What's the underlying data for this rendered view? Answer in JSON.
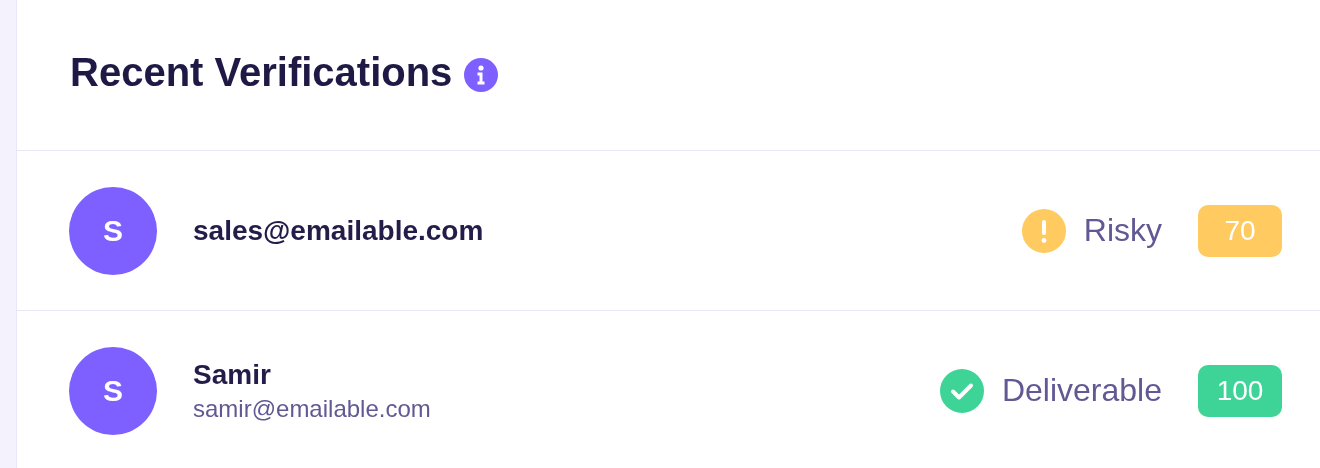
{
  "panel": {
    "title": "Recent Verifications"
  },
  "verifications": [
    {
      "avatar": "S",
      "email": "sales@emailable.com",
      "status": {
        "kind": "risky",
        "label": "Risky"
      },
      "score": "70"
    },
    {
      "avatar": "S",
      "name": "Samir",
      "email": "samir@emailable.com",
      "status": {
        "kind": "deliverable",
        "label": "Deliverable"
      },
      "score": "100"
    }
  ]
}
